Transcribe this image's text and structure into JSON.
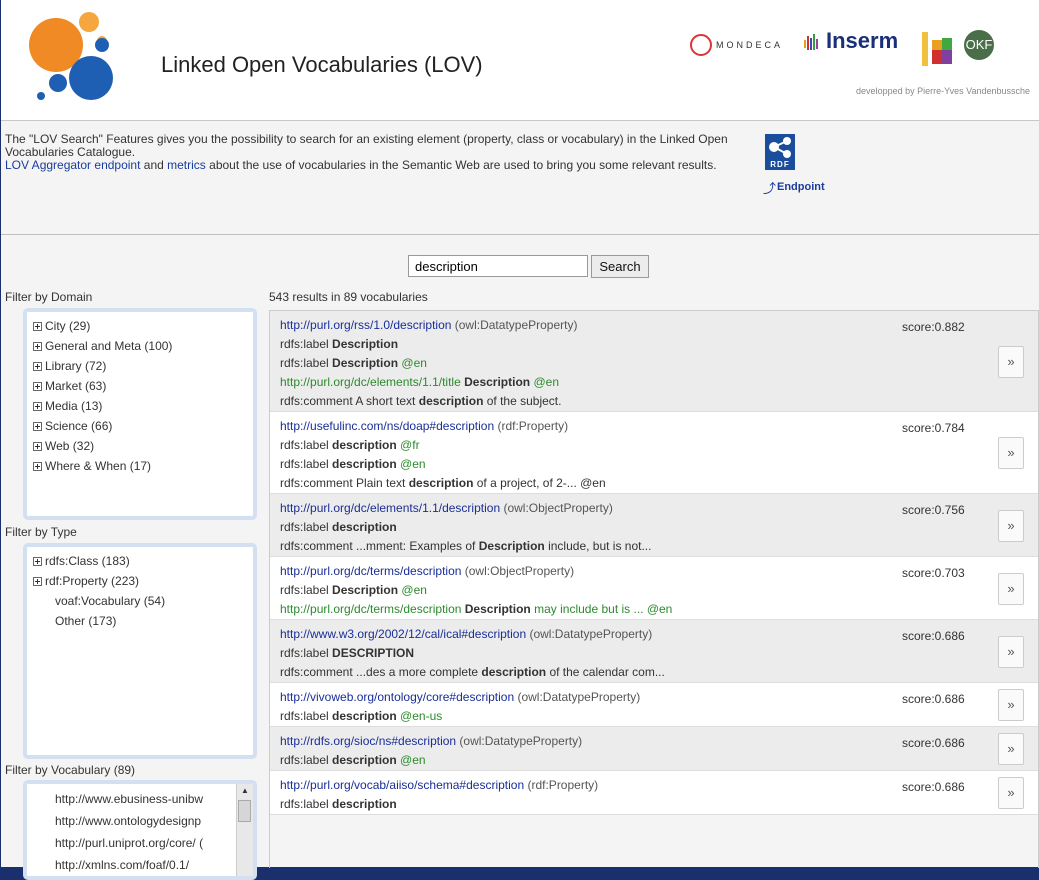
{
  "header": {
    "title": "Linked Open Vocabularies (LOV)",
    "partners": {
      "mondeca": "MONDECA",
      "inserm": "Inserm",
      "okf": "OKF",
      "developed_by": "developped by Pierre-Yves Vandenbussche"
    }
  },
  "intro": {
    "line1": "The \"LOV Search\" Features gives you the possibility to search for an existing element (property, class or vocabulary) in the Linked Open Vocabularies Catalogue.",
    "link_endpoint": "LOV Aggregator endpoint",
    "and": " and ",
    "link_metrics": "metrics",
    "line2_rest": " about the use of vocabularies in the Semantic Web are used to bring you some relevant results.",
    "rdf_label": "RDF",
    "endpoint_label": "Endpoint"
  },
  "search": {
    "value": "description",
    "button_label": "Search",
    "summary": "543 results in 89 vocabularies"
  },
  "filters": {
    "domain": {
      "title": "Filter by Domain",
      "items": [
        "City (29)",
        "General and Meta (100)",
        "Library (72)",
        "Market (63)",
        "Media (13)",
        "Science (66)",
        "Web (32)",
        "Where & When (17)"
      ]
    },
    "type": {
      "title": "Filter by Type",
      "items_plus": [
        "rdfs:Class (183)",
        "rdf:Property (223)"
      ],
      "items_plain": [
        "voaf:Vocabulary (54)",
        "Other (173)"
      ]
    },
    "vocabulary": {
      "title": "Filter by Vocabulary (89)",
      "items": [
        "http://www.ebusiness-unibw",
        "http://www.ontologydesignp",
        "http://purl.uniprot.org/core/ (",
        "http://xmlns.com/foaf/0.1/"
      ]
    }
  },
  "results": [
    {
      "uri": "http://purl.org/rss/1.0/description",
      "type": "(owl:DatatypeProperty)",
      "score": "score:0.882",
      "lines": [
        [
          "rdfs:label ",
          "Description",
          "",
          ""
        ],
        [
          "rdfs:label ",
          "Description",
          " @en",
          ""
        ],
        [
          "http://purl.org/dc/elements/1.1/title ",
          "Description",
          " @en",
          "green"
        ],
        [
          "rdfs:comment A short text ",
          "description",
          " of the subject.",
          "tail"
        ]
      ]
    },
    {
      "uri": "http://usefulinc.com/ns/doap#description",
      "type": "(rdf:Property)",
      "score": "score:0.784",
      "lines": [
        [
          "rdfs:label ",
          "description",
          " @fr",
          ""
        ],
        [
          "rdfs:label ",
          "description",
          " @en",
          ""
        ],
        [
          "rdfs:comment Plain text ",
          "description",
          " of a project, of 2-... @en",
          "tail"
        ]
      ]
    },
    {
      "uri": "http://purl.org/dc/elements/1.1/description",
      "type": "(owl:ObjectProperty)",
      "score": "score:0.756",
      "lines": [
        [
          "rdfs:label ",
          "description",
          "",
          ""
        ],
        [
          "rdfs:comment ...mment: Examples of ",
          "Description",
          " include, but is not...",
          "tail"
        ]
      ]
    },
    {
      "uri": "http://purl.org/dc/terms/description",
      "type": "(owl:ObjectProperty)",
      "score": "score:0.703",
      "lines": [
        [
          "rdfs:label ",
          "Description",
          " @en",
          ""
        ],
        [
          "http://purl.org/dc/terms/description ",
          "Description",
          " may include but is ... @en",
          "green"
        ]
      ]
    },
    {
      "uri": "http://www.w3.org/2002/12/cal/ical#description",
      "type": "(owl:DatatypeProperty)",
      "score": "score:0.686",
      "lines": [
        [
          "rdfs:label ",
          "DESCRIPTION",
          "",
          ""
        ],
        [
          "rdfs:comment ...des a more complete ",
          "description",
          " of the calendar com...",
          "tail"
        ]
      ]
    },
    {
      "uri": "http://vivoweb.org/ontology/core#description",
      "type": "(owl:DatatypeProperty)",
      "score": "score:0.686",
      "lines": [
        [
          "rdfs:label ",
          "description",
          " @en-us",
          ""
        ]
      ]
    },
    {
      "uri": "http://rdfs.org/sioc/ns#description",
      "type": "(owl:DatatypeProperty)",
      "score": "score:0.686",
      "lines": [
        [
          "rdfs:label ",
          "description",
          " @en",
          ""
        ]
      ]
    },
    {
      "uri": "http://purl.org/vocab/aiiso/schema#description",
      "type": "(rdf:Property)",
      "score": "score:0.686",
      "lines": [
        [
          "rdfs:label ",
          "description",
          "",
          ""
        ]
      ]
    }
  ],
  "more_symbol": "»",
  "colors": {
    "frame": "#1a2f6e",
    "link": "#1a2e96",
    "green": "#2c8a2c",
    "shade": "#ececec"
  }
}
